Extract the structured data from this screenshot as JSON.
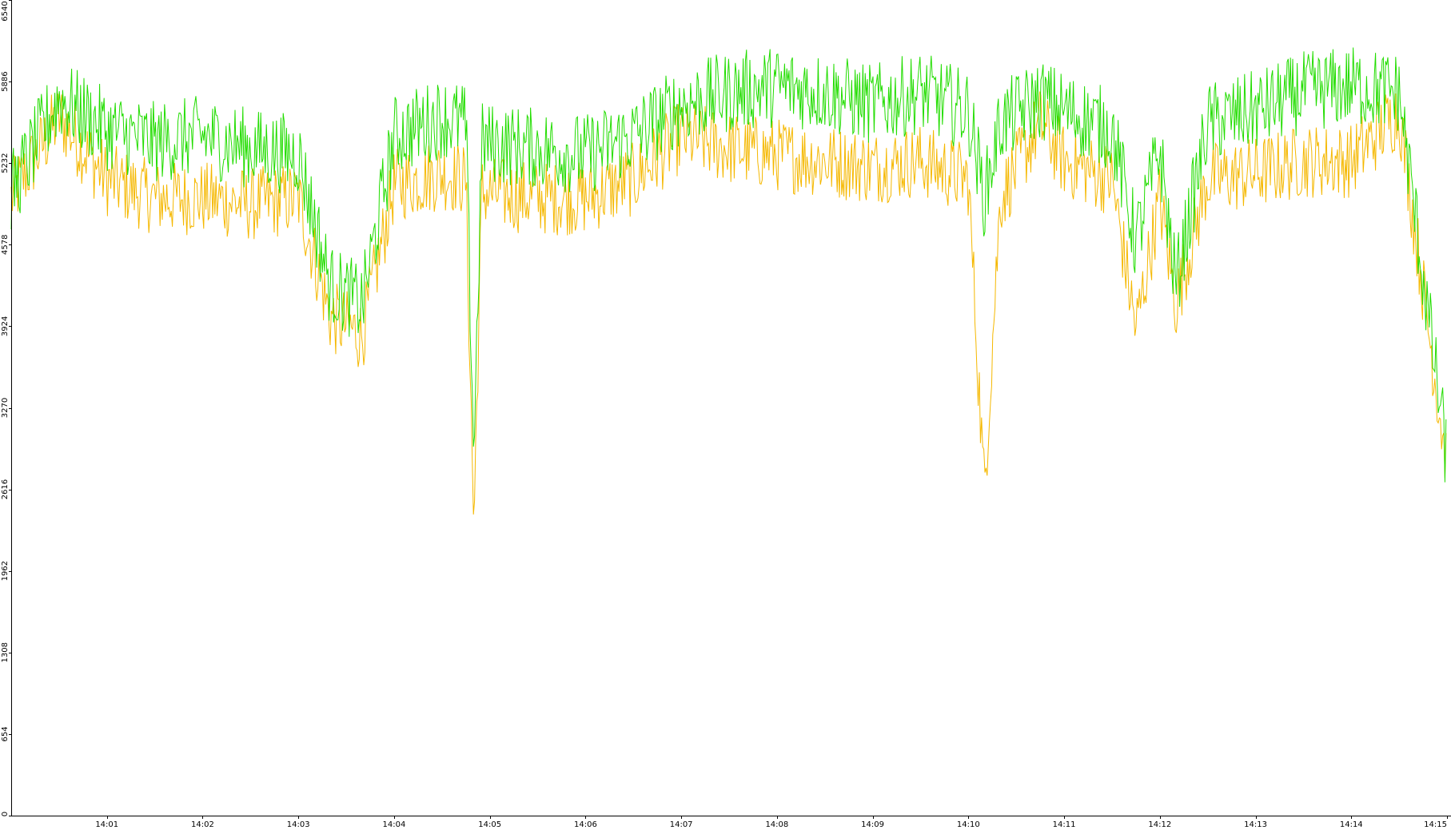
{
  "chart_data": {
    "type": "line",
    "title": "",
    "xlabel": "",
    "ylabel": "",
    "grid": false,
    "legend": "none",
    "x_start": "14:00:00",
    "x_end": "14:15:00",
    "xlim": [
      "14:00:00",
      "14:15:00"
    ],
    "ylim": [
      0,
      6540
    ],
    "y_ticks": [
      0,
      654,
      1308,
      1962,
      2616,
      3270,
      3924,
      4578,
      5232,
      5886,
      6540
    ],
    "y_tick_labels": [
      "0",
      "654",
      "1308",
      "1962",
      "2616",
      "3270",
      "3924",
      "4578",
      "5232",
      "5886",
      "6540"
    ],
    "x_ticks": [
      "14:01",
      "14:02",
      "14:03",
      "14:04",
      "14:05",
      "14:06",
      "14:07",
      "14:08",
      "14:09",
      "14:10",
      "14:11",
      "14:12",
      "14:13",
      "14:14",
      "14:15"
    ],
    "x_tick_labels": [
      "14:01",
      "14:02",
      "14:03",
      "14:04",
      "14:05",
      "14:06",
      "14:07",
      "14:08",
      "14:09",
      "14:10",
      "14:11",
      "14:12",
      "14:13",
      "14:14",
      "14:15"
    ],
    "series": [
      {
        "color": "#22dd00",
        "x": [
          "14:00:00",
          "14:00:30",
          "14:01:00",
          "14:01:30",
          "14:02:00",
          "14:02:30",
          "14:03:00",
          "14:03:20",
          "14:03:40",
          "14:04:00",
          "14:04:30",
          "14:04:45",
          "14:04:50",
          "14:04:55",
          "14:05:30",
          "14:06:00",
          "14:06:30",
          "14:07:00",
          "14:07:30",
          "14:08:00",
          "14:08:30",
          "14:09:00",
          "14:09:30",
          "14:10:00",
          "14:10:10",
          "14:10:20",
          "14:10:45",
          "14:11:00",
          "14:11:30",
          "14:11:45",
          "14:12:00",
          "14:12:10",
          "14:12:30",
          "14:13:00",
          "14:13:30",
          "14:14:00",
          "14:14:30",
          "14:15:00"
        ],
        "values": [
          5000,
          5750,
          5500,
          5400,
          5450,
          5350,
          5300,
          4250,
          4100,
          5450,
          5600,
          5550,
          2900,
          5400,
          5350,
          5300,
          5450,
          5700,
          5800,
          5850,
          5800,
          5700,
          5800,
          5650,
          4950,
          5550,
          5750,
          5650,
          5500,
          4600,
          5350,
          4250,
          5550,
          5650,
          5800,
          5850,
          5800,
          2850
        ]
      },
      {
        "color": "#f5b800",
        "x": [
          "14:00:00",
          "14:00:30",
          "14:01:00",
          "14:01:30",
          "14:02:00",
          "14:02:30",
          "14:03:00",
          "14:03:20",
          "14:03:40",
          "14:04:00",
          "14:04:30",
          "14:04:45",
          "14:04:50",
          "14:04:55",
          "14:05:30",
          "14:06:00",
          "14:06:30",
          "14:07:00",
          "14:07:30",
          "14:08:00",
          "14:08:30",
          "14:09:00",
          "14:09:30",
          "14:10:00",
          "14:10:10",
          "14:10:20",
          "14:10:45",
          "14:11:00",
          "14:11:30",
          "14:11:45",
          "14:12:00",
          "14:12:10",
          "14:12:30",
          "14:13:00",
          "14:13:30",
          "14:14:00",
          "14:14:30",
          "14:15:00"
        ],
        "values": [
          4950,
          5600,
          5100,
          4950,
          4950,
          4900,
          4950,
          4000,
          3850,
          5050,
          5150,
          5100,
          2300,
          5000,
          4950,
          4950,
          5100,
          5450,
          5350,
          5300,
          5250,
          5200,
          5250,
          5100,
          2600,
          4950,
          5550,
          5250,
          5100,
          3900,
          4950,
          4100,
          5100,
          5150,
          5250,
          5250,
          5650,
          2800
        ]
      }
    ]
  }
}
